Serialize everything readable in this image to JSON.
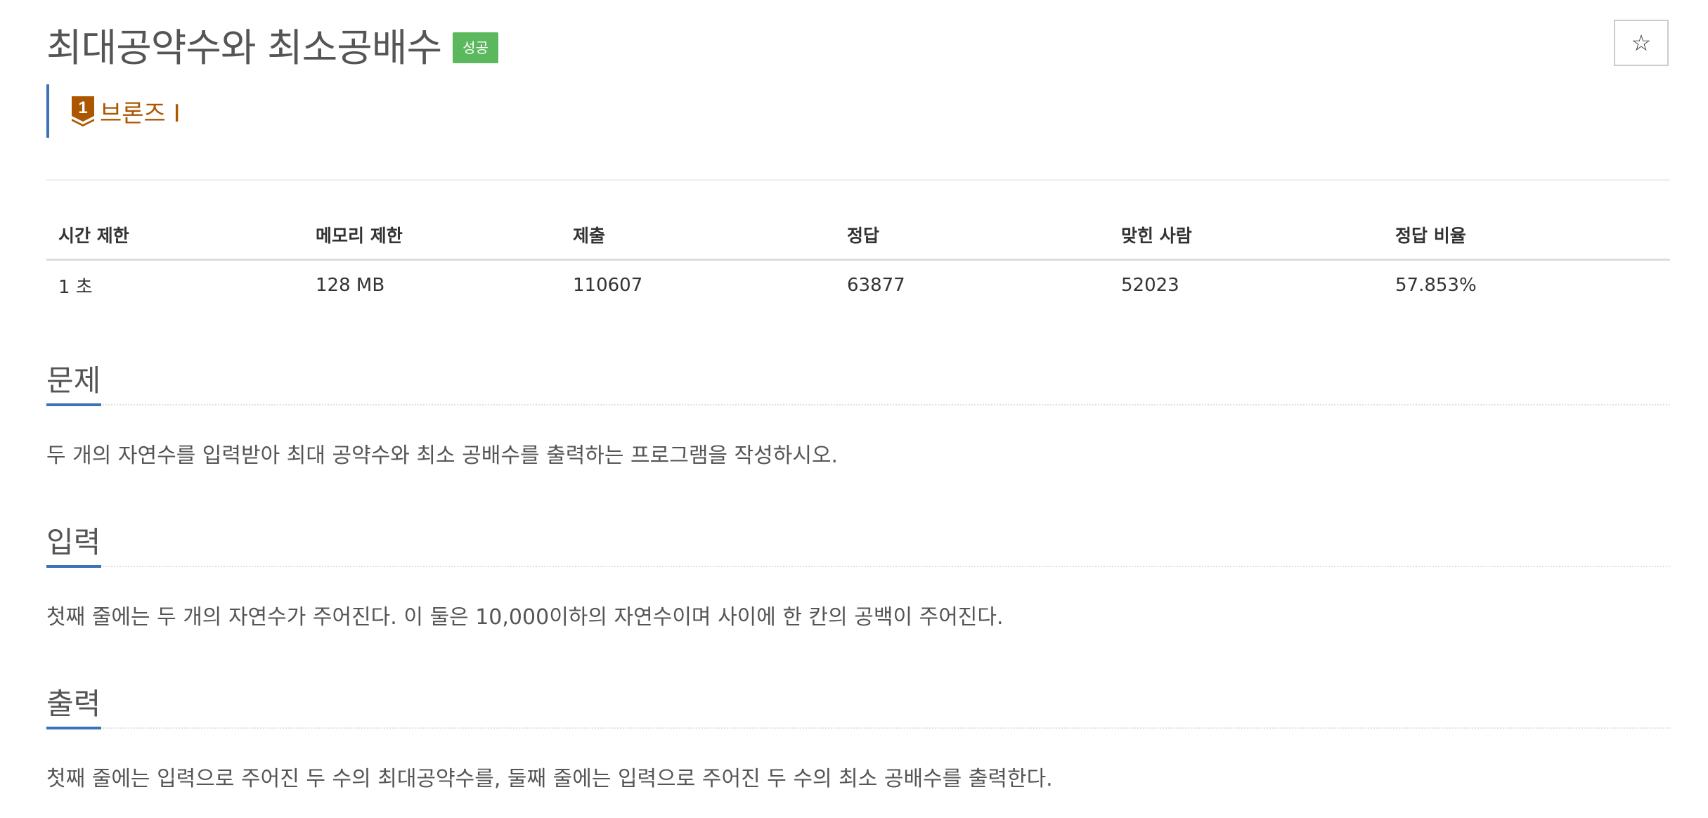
{
  "header": {
    "title": "최대공약수와 최소공배수",
    "status_badge": "성공",
    "star_icon": "star-outline-icon",
    "star_glyph": "☆"
  },
  "tier": {
    "number": "1",
    "label": "브론즈 I",
    "color": "#ad5600"
  },
  "info_table": {
    "headers": [
      "시간 제한",
      "메모리 제한",
      "제출",
      "정답",
      "맞힌 사람",
      "정답 비율"
    ],
    "values": [
      "1 초",
      "128 MB",
      "110607",
      "63877",
      "52023",
      "57.853%"
    ]
  },
  "sections": [
    {
      "title": "문제",
      "body": "두 개의 자연수를 입력받아 최대 공약수와 최소 공배수를 출력하는 프로그램을 작성하시오."
    },
    {
      "title": "입력",
      "body": "첫째 줄에는 두 개의 자연수가 주어진다. 이 둘은 10,000이하의 자연수이며 사이에 한 칸의 공백이 주어진다."
    },
    {
      "title": "출력",
      "body": "첫째 줄에는 입력으로 주어진 두 수의 최대공약수를, 둘째 줄에는 입력으로 주어진 두 수의 최소 공배수를 출력한다."
    }
  ],
  "colors": {
    "accent": "#3b72b8",
    "success": "#5cb85c",
    "bronze": "#ad5600"
  }
}
